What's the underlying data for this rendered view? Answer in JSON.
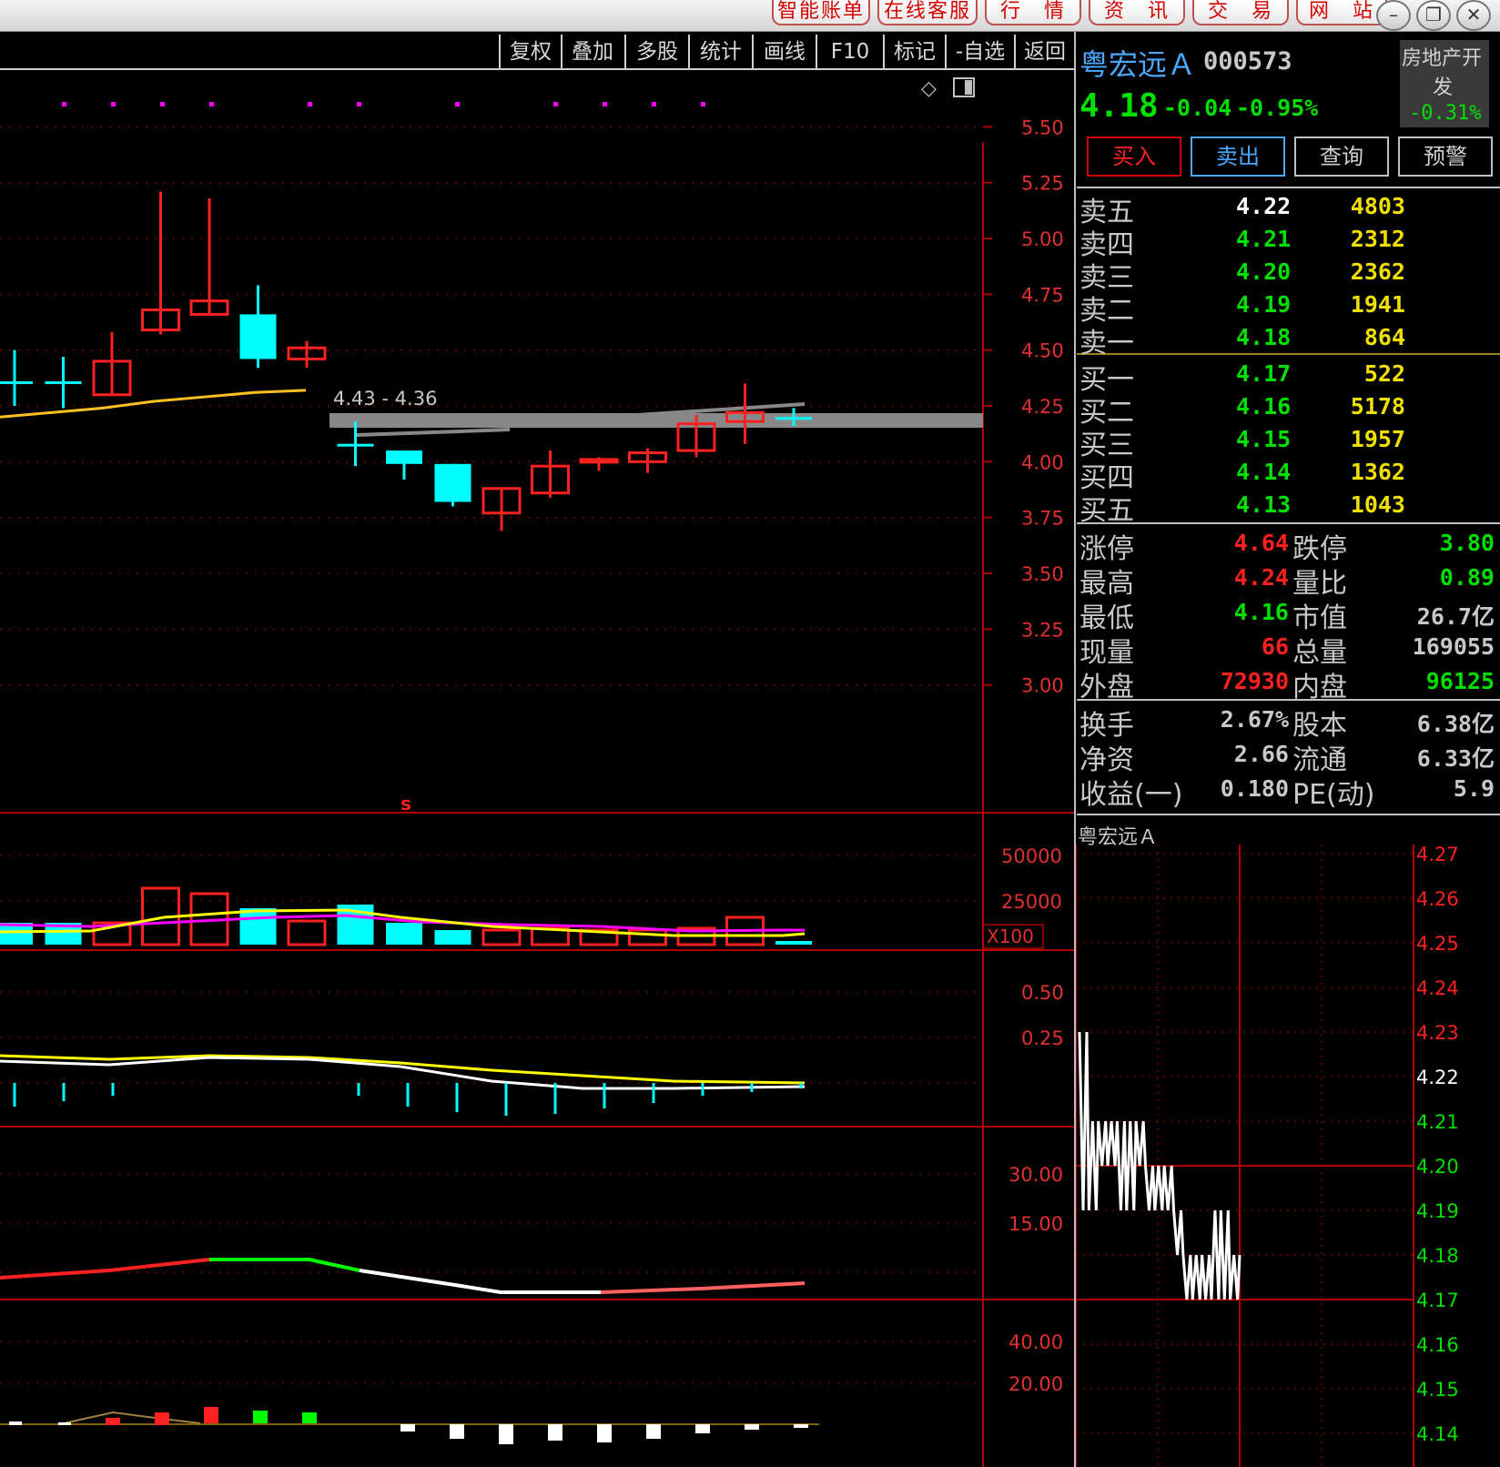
{
  "topbar": {
    "buttons": [
      "智能账单",
      "在线客服",
      "行　情",
      "资　讯",
      "交　易",
      "网　站"
    ],
    "window_controls": [
      "minimize-icon",
      "restore-icon",
      "close-icon"
    ]
  },
  "toolbar": {
    "items": [
      "复权",
      "叠加",
      "多股",
      "统计",
      "画线",
      "F10",
      "标记",
      "-自选",
      "返回"
    ]
  },
  "main_chart": {
    "price_axis": [
      "5.50",
      "5.25",
      "5.00",
      "4.75",
      "4.50",
      "4.25",
      "4.00",
      "3.75",
      "3.50",
      "3.25",
      "3.00"
    ],
    "annotation": "4.43 - 4.36",
    "marker": "s",
    "volume_axis": [
      "50000",
      "25000"
    ],
    "volume_unit": "X100",
    "ind1_axis": [
      "0.50",
      "0.25"
    ],
    "ind2_axis": [
      "30.00",
      "15.00"
    ],
    "ind3_axis": [
      "40.00",
      "20.00"
    ]
  },
  "quote": {
    "name": "粤宏远Ａ",
    "code": "000573",
    "sector_line1": "房地产开",
    "sector_line2": "发",
    "sector_change": "-0.31%",
    "price": "4.18",
    "change": "-0.04",
    "change_pct": "-0.95%",
    "buttons": {
      "buy": "买入",
      "sell": "卖出",
      "query": "查询",
      "alert": "预警"
    },
    "asks": [
      {
        "label": "卖五",
        "price": "4.22",
        "vol": "4803"
      },
      {
        "label": "卖四",
        "price": "4.21",
        "vol": "2312"
      },
      {
        "label": "卖三",
        "price": "4.20",
        "vol": "2362"
      },
      {
        "label": "卖二",
        "price": "4.19",
        "vol": "1941"
      },
      {
        "label": "卖一",
        "price": "4.18",
        "vol": "864"
      }
    ],
    "bids": [
      {
        "label": "买一",
        "price": "4.17",
        "vol": "522"
      },
      {
        "label": "买二",
        "price": "4.16",
        "vol": "5178"
      },
      {
        "label": "买三",
        "price": "4.15",
        "vol": "1957"
      },
      {
        "label": "买四",
        "price": "4.14",
        "vol": "1362"
      },
      {
        "label": "买五",
        "price": "4.13",
        "vol": "1043"
      }
    ],
    "stats1": [
      {
        "l1": "涨停",
        "v1": "4.64",
        "l2": "跌停",
        "v2": "3.80"
      },
      {
        "l1": "最高",
        "v1": "4.24",
        "l2": "量比",
        "v2": "0.89"
      },
      {
        "l1": "最低",
        "v1": "4.16",
        "l2": "市值",
        "v2": "26.7亿"
      },
      {
        "l1": "现量",
        "v1": "66",
        "l2": "总量",
        "v2": "169055"
      },
      {
        "l1": "外盘",
        "v1": "72930",
        "l2": "内盘",
        "v2": "96125"
      }
    ],
    "stats2": [
      {
        "l1": "换手",
        "v1": "2.67%",
        "l2": "股本",
        "v2": "6.38亿"
      },
      {
        "l1": "净资",
        "v1": "2.66",
        "l2": "流通",
        "v2": "6.33亿"
      },
      {
        "l1": "收益(一)",
        "v1": "0.180",
        "l2": "PE(动)",
        "v2": "5.9"
      }
    ]
  },
  "mini_chart": {
    "title": "粤宏远Ａ",
    "axis": [
      "4.27",
      "4.26",
      "4.25",
      "4.24",
      "4.23",
      "4.22",
      "4.21",
      "4.20",
      "4.19",
      "4.18",
      "4.17",
      "4.16",
      "4.15",
      "4.14"
    ]
  },
  "chart_data": {
    "type": "candlestick",
    "title": "",
    "ylim": [
      2.75,
      5.75
    ],
    "candles": [
      {
        "o": 4.36,
        "c": 4.36,
        "h": 4.5,
        "l": 4.25,
        "color": "cyan"
      },
      {
        "o": 4.36,
        "c": 4.36,
        "h": 4.47,
        "l": 4.24,
        "color": "cyan"
      },
      {
        "o": 4.3,
        "c": 4.45,
        "h": 4.58,
        "l": 4.3,
        "color": "red"
      },
      {
        "o": 4.59,
        "c": 4.68,
        "h": 5.21,
        "l": 4.57,
        "color": "red"
      },
      {
        "o": 4.66,
        "c": 4.72,
        "h": 5.18,
        "l": 4.66,
        "color": "red"
      },
      {
        "o": 4.66,
        "c": 4.46,
        "h": 4.79,
        "l": 4.42,
        "color": "cyan"
      },
      {
        "o": 4.46,
        "c": 4.51,
        "h": 4.54,
        "l": 4.42,
        "color": "red"
      },
      {
        "o": 4.08,
        "c": 4.08,
        "h": 4.18,
        "l": 3.98,
        "color": "cyan"
      },
      {
        "o": 4.05,
        "c": 3.99,
        "h": 4.05,
        "l": 3.92,
        "color": "cyan"
      },
      {
        "o": 3.99,
        "c": 3.82,
        "h": 3.99,
        "l": 3.8,
        "color": "cyan"
      },
      {
        "o": 3.77,
        "c": 3.88,
        "h": 3.88,
        "l": 3.69,
        "color": "red"
      },
      {
        "o": 3.86,
        "c": 3.98,
        "h": 4.05,
        "l": 3.84,
        "color": "red"
      },
      {
        "o": 4.0,
        "c": 4.01,
        "h": 4.02,
        "l": 3.96,
        "color": "red"
      },
      {
        "o": 4.0,
        "c": 4.04,
        "h": 4.06,
        "l": 3.95,
        "color": "red"
      },
      {
        "o": 4.05,
        "c": 4.17,
        "h": 4.21,
        "l": 4.02,
        "color": "red"
      },
      {
        "o": 4.18,
        "c": 4.22,
        "h": 4.35,
        "l": 4.08,
        "color": "red"
      },
      {
        "o": 4.2,
        "c": 4.2,
        "h": 4.24,
        "l": 4.16,
        "color": "cyan"
      }
    ],
    "ma_line": [
      4.2,
      4.22,
      4.24,
      4.27,
      4.29,
      4.31,
      4.32
    ],
    "volume_ylim": [
      0,
      60000
    ],
    "volume": [
      {
        "v": 12000,
        "color": "cyan"
      },
      {
        "v": 12000,
        "color": "cyan"
      },
      {
        "v": 12000,
        "color": "red"
      },
      {
        "v": 31000,
        "color": "red"
      },
      {
        "v": 28000,
        "color": "red"
      },
      {
        "v": 20000,
        "color": "cyan"
      },
      {
        "v": 13000,
        "color": "red"
      },
      {
        "v": 22000,
        "color": "cyan"
      },
      {
        "v": 12000,
        "color": "cyan"
      },
      {
        "v": 8000,
        "color": "cyan"
      },
      {
        "v": 8000,
        "color": "red"
      },
      {
        "v": 9000,
        "color": "red"
      },
      {
        "v": 8000,
        "color": "red"
      },
      {
        "v": 8000,
        "color": "red"
      },
      {
        "v": 9000,
        "color": "red"
      },
      {
        "v": 15000,
        "color": "red"
      },
      {
        "v": 2000,
        "color": "cyan"
      }
    ],
    "mini_prices": [
      4.23,
      4.19,
      4.21,
      4.2,
      4.21,
      4.19,
      4.21,
      4.2,
      4.19,
      4.2,
      4.19,
      4.18,
      4.17,
      4.18,
      4.17,
      4.19,
      4.17,
      4.18
    ]
  },
  "colors": {
    "up": "#ff2020",
    "down": "#00ffff",
    "grid": "#b00000",
    "ma": "#ffc020"
  }
}
